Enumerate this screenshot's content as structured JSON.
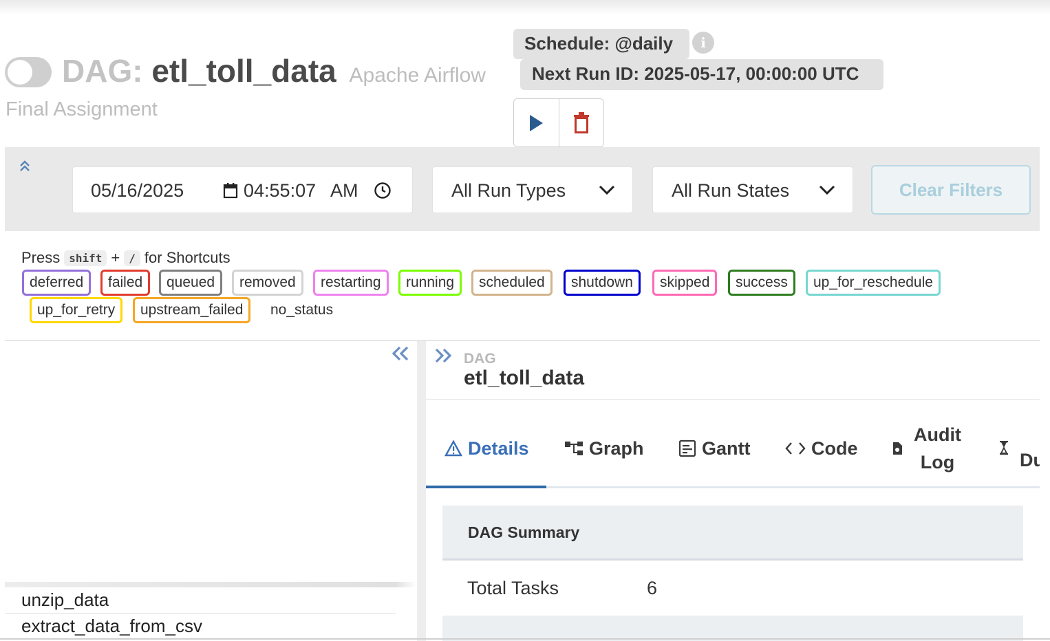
{
  "header": {
    "dag_prefix": "DAG:",
    "dag_id": "etl_toll_data",
    "app_name": "Apache Airflow",
    "description": "Final Assignment",
    "schedule": "Schedule: @daily",
    "next_run": "Next Run ID: 2025-05-17, 00:00:00 UTC",
    "info_icon": "i"
  },
  "filters": {
    "date": "05/16/2025",
    "time": "04:55:07",
    "ampm": "AM",
    "run_type": "All Run Types",
    "run_state": "All Run States",
    "clear_label": "Clear Filters"
  },
  "legend": {
    "press": "Press",
    "key1": "shift",
    "plus": "+",
    "key2": "/",
    "for_shortcuts": "for Shortcuts",
    "states": [
      {
        "label": "deferred",
        "color": "#9370db"
      },
      {
        "label": "failed",
        "color": "#e23b2e"
      },
      {
        "label": "queued",
        "color": "#808080"
      },
      {
        "label": "removed",
        "color": "#d3d3d3"
      },
      {
        "label": "restarting",
        "color": "#ee82ee"
      },
      {
        "label": "running",
        "color": "#7cfc00"
      },
      {
        "label": "scheduled",
        "color": "#d2b48c"
      },
      {
        "label": "shutdown",
        "color": "#0000cd"
      },
      {
        "label": "skipped",
        "color": "#ff69b4"
      },
      {
        "label": "success",
        "color": "#2e7d1f"
      },
      {
        "label": "up_for_reschedule",
        "color": "#76d7d0"
      },
      {
        "label": "up_for_retry",
        "color": "#ffd700"
      },
      {
        "label": "upstream_failed",
        "color": "#f5a623"
      },
      {
        "label": "no_status",
        "color": "transparent"
      }
    ]
  },
  "grid": {
    "tasks": [
      "unzip_data",
      "extract_data_from_csv"
    ]
  },
  "details": {
    "kind_label": "DAG",
    "dag_id": "etl_toll_data",
    "tabs": [
      {
        "label": "Details",
        "icon": "warning-triangle-icon",
        "active": true
      },
      {
        "label": "Graph",
        "icon": "graph-icon"
      },
      {
        "label": "Gantt",
        "icon": "gantt-icon"
      },
      {
        "label": "Code",
        "icon": "code-icon"
      },
      {
        "label_line1": "Audit",
        "label_line2": "Log",
        "icon": "file-icon"
      },
      {
        "label": "Du",
        "icon": "hourglass-icon"
      }
    ],
    "summary_title": "DAG Summary",
    "total_tasks_label": "Total Tasks",
    "total_tasks_value": "6"
  },
  "colors": {
    "accent": "#2f6aa8",
    "play": "#2a5a8e",
    "delete": "#c0392b"
  }
}
